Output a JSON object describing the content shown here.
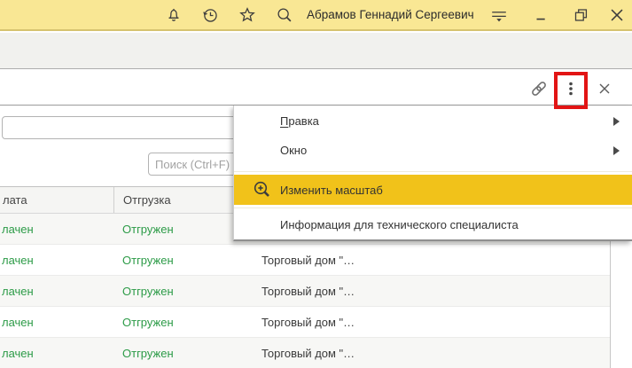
{
  "titlebar": {
    "username": "Абрамов Геннадий Сергеевич"
  },
  "toolbar_icons": [
    "notifications-icon",
    "history-icon",
    "favorites-icon",
    "search-icon",
    "service-menu-icon",
    "minimize-icon",
    "restore-icon",
    "close-icon"
  ],
  "form_header_icons": [
    "link-icon",
    "kebab-menu-icon",
    "close-form-icon"
  ],
  "annotation": {
    "highlight_color": "#e21414",
    "target": "kebab-menu-icon"
  },
  "form": {
    "title_input_value": "",
    "search": {
      "placeholder": "Поиск (Ctrl+F)"
    }
  },
  "menu": {
    "items": [
      {
        "label": "Правка",
        "hotkey": "П",
        "label_rest": "равка",
        "has_submenu": true
      },
      {
        "label": "Окно",
        "has_submenu": true
      },
      {
        "label": "Изменить масштаб",
        "icon": "zoom-in-icon",
        "highlighted": true
      },
      {
        "label": "Информация для технического специалиста"
      }
    ],
    "highlight_color": "#f1c21a"
  },
  "table": {
    "columns": [
      {
        "label": "лата"
      },
      {
        "label": "Отгрузка"
      },
      {
        "label": ""
      }
    ],
    "status_color": "#2c9b47",
    "rows": [
      {
        "payment": "лачен",
        "shipment": "Отгружен",
        "customer": ""
      },
      {
        "payment": "лачен",
        "shipment": "Отгружен",
        "customer": "Торговый дом \"…"
      },
      {
        "payment": "лачен",
        "shipment": "Отгружен",
        "customer": "Торговый дом \"…"
      },
      {
        "payment": "лачен",
        "shipment": "Отгружен",
        "customer": "Торговый дом \"…"
      },
      {
        "payment": "лачен",
        "shipment": "Отгружен",
        "customer": "Торговый дом \"…"
      }
    ]
  }
}
